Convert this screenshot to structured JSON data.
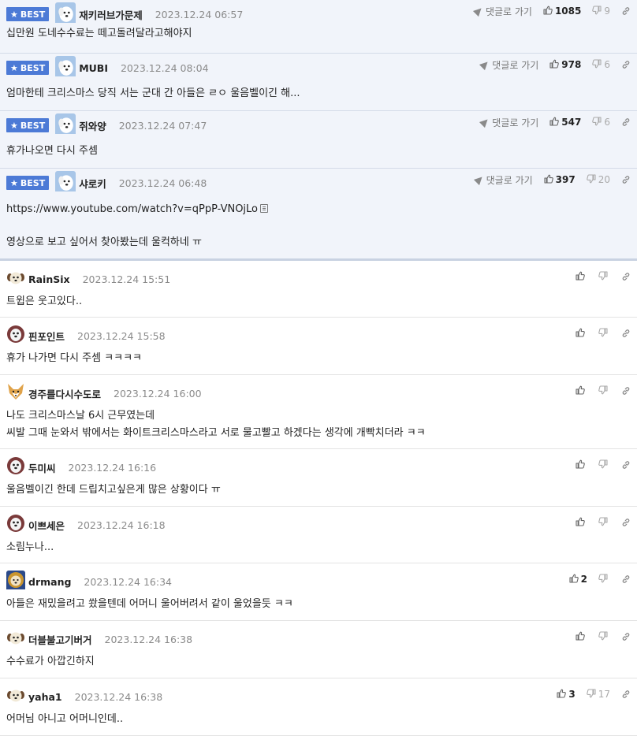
{
  "labels": {
    "best": "BEST",
    "reply_link": "댓글로 가기"
  },
  "best_comments": [
    {
      "nick": "재키러브가문제",
      "date": "2023.12.24 06:57",
      "lines": [
        "십만원 도네수수료는 떼고돌려달라고해야지"
      ],
      "up": "1085",
      "down": "9",
      "avatar_icon": "white-dog-avatar-icon"
    },
    {
      "nick": "MUBI",
      "date": "2023.12.24 08:04",
      "lines": [
        "엄마한테 크리스마스 당직 서는 군대 간 아들은 ㄹㅇ 울음벨이긴 해..."
      ],
      "up": "978",
      "down": "6",
      "avatar_icon": "white-dog-avatar-icon"
    },
    {
      "nick": "쥐와양",
      "date": "2023.12.24 07:47",
      "lines": [
        "휴가나오면 다시 주셈"
      ],
      "up": "547",
      "down": "6",
      "avatar_icon": "white-dog-avatar-icon"
    },
    {
      "nick": "샤로키",
      "date": "2023.12.24 06:48",
      "link": "https://www.youtube.com/watch?v=qPpP-VNOjLo",
      "lines": [
        "영상으로 보고 싶어서 찾아봤는데 울컥하네 ㅠ"
      ],
      "up": "397",
      "down": "20",
      "avatar_icon": "white-dog-avatar-icon"
    }
  ],
  "comments": [
    {
      "nick": "RainSix",
      "date": "2023.12.24 15:51",
      "lines": [
        "트윕은 웃고있다.."
      ],
      "up": "",
      "down": "",
      "avatar_icon": "puppy-avatar-icon"
    },
    {
      "nick": "핀포인트",
      "date": "2023.12.24 15:58",
      "lines": [
        "휴가 나가면 다시 주셈 ㅋㅋㅋㅋ"
      ],
      "up": "",
      "down": "",
      "avatar_icon": "sheepdog-avatar-icon"
    },
    {
      "nick": "경주를다시수도로",
      "date": "2023.12.24 16:00",
      "lines": [
        "나도 크리스마스날 6시 근무였는데",
        "씨발 그때 눈와서 밖에서는 화이트크리스마스라고 서로 물고빨고 하겠다는 생각에 개빡치더라 ㅋㅋ"
      ],
      "up": "",
      "down": "",
      "avatar_icon": "fox-avatar-icon"
    },
    {
      "nick": "두미씨",
      "date": "2023.12.24 16:16",
      "lines": [
        "울음벨이긴 한데 드립치고싶은게 많은 상황이다 ㅠ"
      ],
      "up": "",
      "down": "",
      "avatar_icon": "sheepdog-avatar-icon"
    },
    {
      "nick": "이쁘세은",
      "date": "2023.12.24 16:18",
      "lines": [
        "소림누나..."
      ],
      "up": "",
      "down": "",
      "avatar_icon": "sheepdog-avatar-icon"
    },
    {
      "nick": "drmang",
      "date": "2023.12.24 16:34",
      "lines": [
        "아들은 재밌을려고 쐈을텐데 어머니 울어버려서 같이 울었을듯 ㅋㅋ"
      ],
      "up": "2",
      "down": "",
      "avatar_icon": "lion-avatar-icon"
    },
    {
      "nick": "더블불고기버거",
      "date": "2023.12.24 16:38",
      "lines": [
        "수수료가 아깝긴하지"
      ],
      "up": "",
      "down": "",
      "avatar_icon": "puppy-avatar-icon"
    },
    {
      "nick": "yaha1",
      "date": "2023.12.24 16:38",
      "lines": [
        "어머님 아니고 어머니인데.."
      ],
      "up": "3",
      "down": "17",
      "avatar_icon": "puppy-avatar-icon"
    }
  ],
  "colors": {
    "best_badge": "#4c7ad6",
    "best_background": "#f1f4fa",
    "date": "#8a8a8a",
    "icon": "#777777"
  }
}
